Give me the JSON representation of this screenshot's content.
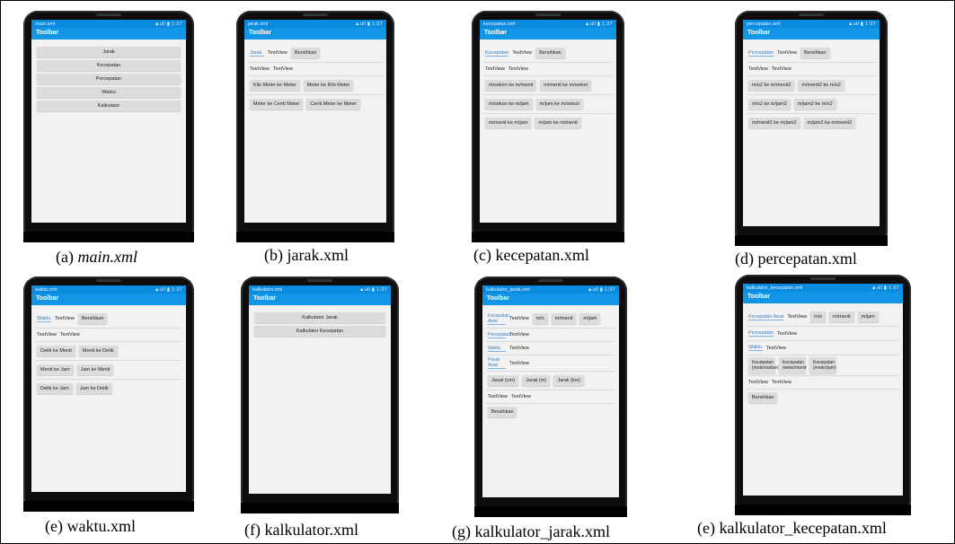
{
  "status": {
    "time": "1:37",
    "signal": "▲ull ▮"
  },
  "toolbar_title": "Toolbar",
  "captions": {
    "a_prefix": "(a) ",
    "a_name": "main.xml",
    "b": "(b) jarak.xml",
    "c": "(c) kecepatan.xml",
    "d": "(d) percepatan.xml",
    "e": "(e) waktu.xml",
    "f": "(f) kalkulator.xml",
    "g": "(g) kalkulator_jarak.xml",
    "h": "(e) kalkulator_kecepatan.xml"
  },
  "screens": {
    "main": {
      "file": "main.xml",
      "buttons": [
        "Jarak",
        "Kecepatan",
        "Percepatan",
        "Waktu",
        "Kalkulator"
      ]
    },
    "jarak": {
      "file": "jarak.xml",
      "link": "Jarak",
      "tv": "TextView",
      "clear": "Bersihkan",
      "result": [
        "TextView",
        "TextView"
      ],
      "buttons": [
        "Kilo Meter ke Meter",
        "Meter ke Kilo Meter",
        "Meter ke Centi Meter",
        "Centi Meter ke Meter"
      ]
    },
    "kecepatan": {
      "file": "kecepatan.xml",
      "link": "Kecepatan",
      "tv": "TextView",
      "clear": "Bersihkan",
      "result": [
        "TextView",
        "TextView"
      ],
      "buttons": [
        "m/sekon ke m/menit",
        "m/menit ke m/sekon",
        "m/sekon ke m/jam",
        "m/jam ke m/sekon",
        "m/menit ke m/jam",
        "m/jam ke m/menit"
      ]
    },
    "percepatan": {
      "file": "percepatan.xml",
      "link": "Percepatan",
      "tv": "TextView",
      "clear": "Bersihkan",
      "result": [
        "TextView",
        "TextView"
      ],
      "buttons": [
        "m/s2 ke m/menit2",
        "m/menit2 ke m/s2",
        "m/s2 ke m/jam2",
        "m/jam2 ke m/s2",
        "m/menit2 ke m/jam2",
        "m/jam2 ke m/menit2"
      ]
    },
    "waktu": {
      "file": "waktu.xml",
      "link": "Waktu",
      "tv": "TextView",
      "clear": "Bersihkan",
      "result": [
        "TextView",
        "TextView"
      ],
      "buttons": [
        "Detik ke Menit",
        "Menit ke Detik",
        "Menit ke Jam",
        "Jam ke Menit",
        "Detik ke Jam",
        "Jam ke Detik"
      ]
    },
    "kalkulator": {
      "file": "kalkulator.xml",
      "buttons": [
        "Kalkulator Jarak",
        "Kalkulator Kecepatan"
      ]
    },
    "kalkulator_jarak": {
      "file": "kalkulator_jarak.xml",
      "fields": [
        "Kecepatan Awal",
        "Percepatan",
        "Waktu",
        "Posisi Awal"
      ],
      "tv": "TextView",
      "speed_units": [
        "m/s",
        "m/menit",
        "m/jam"
      ],
      "dist_units": [
        "Jarak (cm)",
        "Jarak (m)",
        "Jarak (km)"
      ],
      "result": [
        "TextView",
        "TextView"
      ],
      "clear": "Bersihkan"
    },
    "kalkulator_kecepatan": {
      "file": "kalkulator_kecepatan.xml",
      "fields": [
        "Kecepatan Awal",
        "Percepatan",
        "Waktu"
      ],
      "tv": "TextView",
      "speed_units": [
        "m/s",
        "m/menit",
        "m/jam"
      ],
      "out_units": [
        "Kecepatan (meter/sekon)",
        "Kecepatan meter/menit",
        "Kecepatan (meter/jam)"
      ],
      "result": [
        "TextView",
        "TextView"
      ],
      "clear": "Bersihkan"
    }
  }
}
